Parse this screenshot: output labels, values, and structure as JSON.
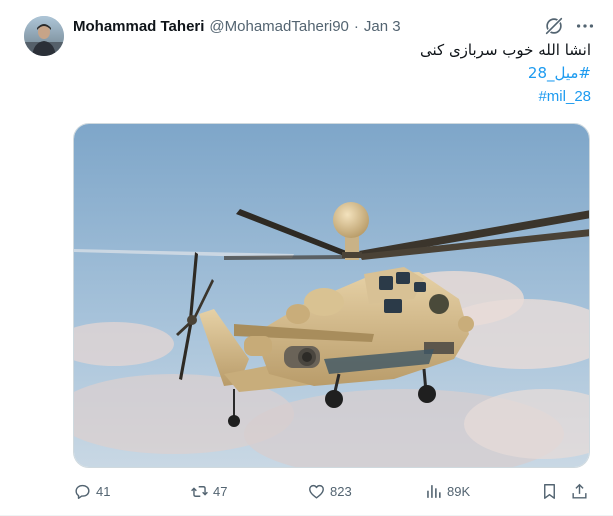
{
  "tweet": {
    "author_name": "Mohammad Taheri",
    "author_handle": "@MohamadTaheri90",
    "separator": "·",
    "date": "Jan 3",
    "text_line": "انشا الله خوب سربازی کنی",
    "hashtag_fa": "#میل_28",
    "hashtag_en": "#mil_28"
  },
  "actions": {
    "replies": "41",
    "reposts": "47",
    "likes": "823",
    "views": "89K"
  },
  "icons": {
    "avatar": "avatar",
    "grok": "grok-icon",
    "more": "more-icon",
    "reply": "reply-icon",
    "repost": "repost-icon",
    "like": "heart-icon",
    "views": "views-chart-icon",
    "bookmark": "bookmark-icon",
    "share": "share-icon"
  },
  "colors": {
    "link": "#1d9bf0",
    "secondary_text": "#536471",
    "primary_text": "#0f1419"
  }
}
